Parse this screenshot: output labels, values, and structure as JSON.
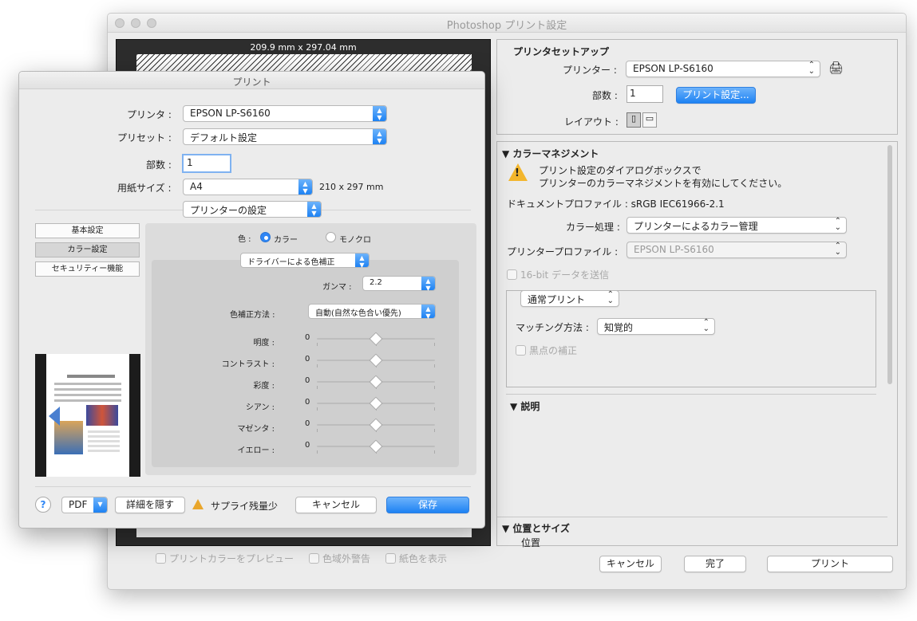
{
  "ps": {
    "title": "Photoshop プリント設定",
    "preview": {
      "size_label": "209.9 mm x 297.04 mm"
    },
    "bottom_checks": [
      "プリントカラーをプレビュー",
      "色域外警告",
      "紙色を表示"
    ],
    "setup": {
      "heading": "プリンタセットアップ",
      "printer_label": "プリンター :",
      "printer_value": "EPSON LP-S6160",
      "copies_label": "部数 :",
      "copies_value": "1",
      "print_settings_btn": "プリント設定...",
      "layout_label": "レイアウト :"
    },
    "color": {
      "heading": "カラーマネジメント",
      "warning_line1": "プリント設定のダイアログボックスで",
      "warning_line2": "プリンターのカラーマネジメントを有効にしてください。",
      "doc_profile": "ドキュメントプロファイル : sRGB IEC61966-2.1",
      "handling_label": "カラー処理 :",
      "handling_value": "プリンターによるカラー管理",
      "profile_label": "プリンタープロファイル :",
      "profile_value": "EPSON LP-S6160",
      "bit16": "16-bit データを送信",
      "normal_print": "通常プリント",
      "matching_label": "マッチング方法 :",
      "matching_value": "知覚的",
      "blackpoint": "黒点の補正"
    },
    "description_heading": "説明",
    "position_heading": "位置とサイズ",
    "position_sub": "位置",
    "buttons": {
      "cancel": "キャンセル",
      "done": "完了",
      "print": "プリント"
    }
  },
  "pd": {
    "title": "プリント",
    "printer_label": "プリンタ :",
    "printer_value": "EPSON LP-S6160",
    "preset_label": "プリセット :",
    "preset_value": "デフォルト設定",
    "copies_label": "部数 :",
    "copies_value": "1",
    "paper_label": "用紙サイズ :",
    "paper_value": "A4",
    "paper_dims": "210 x 297 mm",
    "section_value": "プリンターの設定",
    "tabs": [
      "基本設定",
      "カラー設定",
      "セキュリティー機能"
    ],
    "color_label": "色 :",
    "color_opt1": "カラー",
    "color_opt2": "モノクロ",
    "correction_value": "ドライバーによる色補正",
    "gamma_label": "ガンマ :",
    "gamma_value": "2.2",
    "method_label": "色補正方法 :",
    "method_value": "自動(自然な色合い優先)",
    "sliders": [
      {
        "label": "明度 :",
        "value": "0",
        "level": 0.5
      },
      {
        "label": "コントラスト :",
        "value": "0",
        "level": 0.5
      },
      {
        "label": "彩度 :",
        "value": "0",
        "level": 0.5
      },
      {
        "label": "シアン :",
        "value": "0",
        "level": 0.5
      },
      {
        "label": "マゼンタ :",
        "value": "0",
        "level": 0.5
      },
      {
        "label": "イエロー :",
        "value": "0",
        "level": 0.5
      }
    ],
    "help": "?",
    "pdf": "PDF",
    "hide_details": "詳細を隠す",
    "supply_warning": "サプライ残量少",
    "cancel": "キャンセル",
    "save": "保存"
  }
}
